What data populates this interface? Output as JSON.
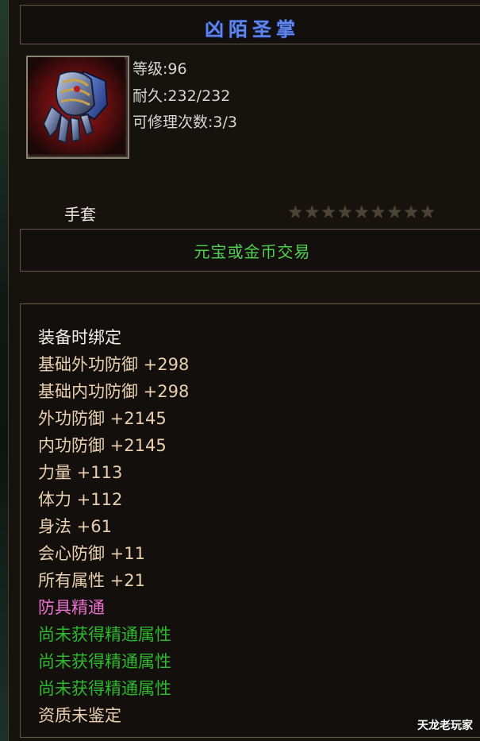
{
  "item": {
    "name": "凶陌圣掌",
    "level": "等级:96",
    "durability": "耐久:232/232",
    "repair_count": "可修理次数:3/3",
    "type": "手套",
    "star_count": 9,
    "trade": "元宝或金币交易"
  },
  "attributes": {
    "bind": "装备时绑定",
    "base_ext_def": "基础外功防御 +298",
    "base_int_def": "基础内功防御 +298",
    "ext_def": "外功防御 +2145",
    "int_def": "内功防御 +2145",
    "strength": "力量 +113",
    "stamina": "体力 +112",
    "agility": "身法 +61",
    "crit_def": "会心防御 +11",
    "all_attr": "所有属性 +21",
    "mastery_title": "防具精通",
    "mastery_1": "尚未获得精通属性",
    "mastery_2": "尚未获得精通属性",
    "mastery_3": "尚未获得精通属性",
    "quality": "资质未鉴定"
  },
  "watermark": "天龙老玩家",
  "colors": {
    "title": "#5f86e8",
    "trade": "#4fd14f",
    "stat_tan": "#e9cfaf",
    "mastery_pink": "#ec6fcf",
    "mastery_green": "#2fb82f"
  },
  "icons": {
    "item_icon": "gauntlet-icon",
    "star_icon": "star-icon"
  }
}
